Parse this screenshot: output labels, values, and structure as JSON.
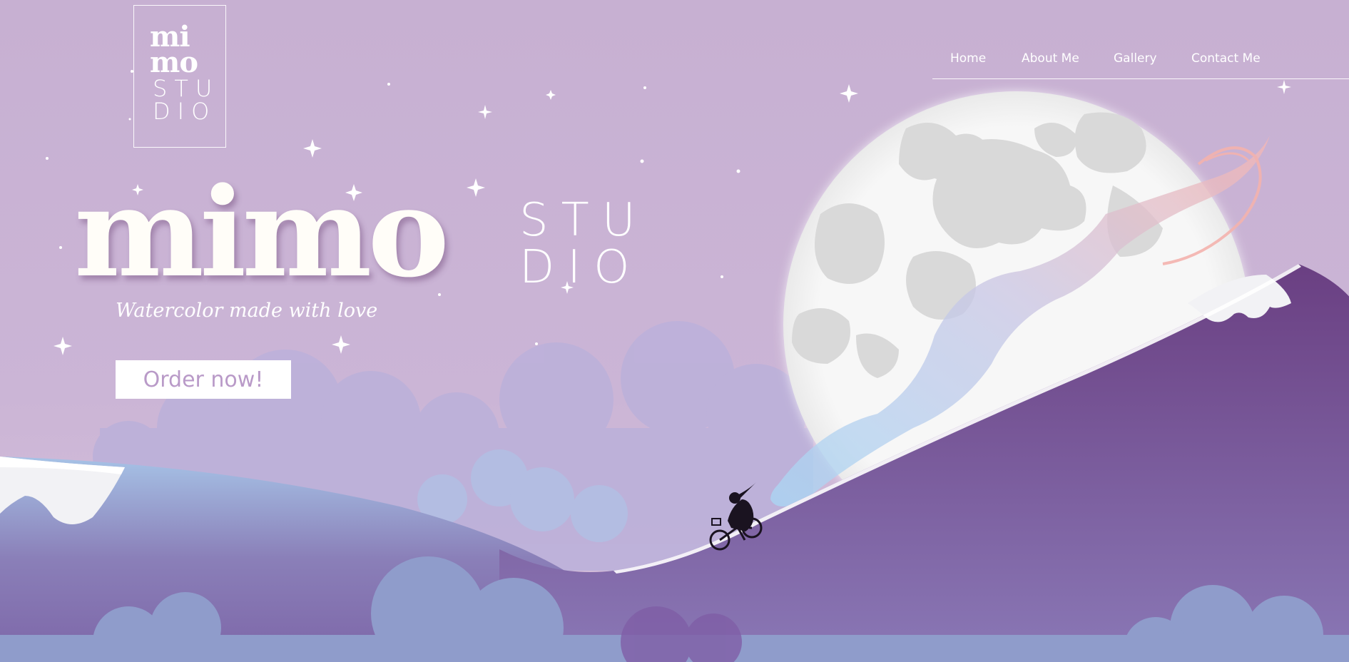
{
  "logo": {
    "line1": "mi mo",
    "line2": "STU DIO"
  },
  "nav": {
    "items": [
      {
        "label": "Home"
      },
      {
        "label": "About Me"
      },
      {
        "label": "Gallery"
      },
      {
        "label": "Contact Me"
      }
    ]
  },
  "hero": {
    "title": "mimo",
    "studio": "STU DIO",
    "tagline": "Watercolor made with love",
    "order_label": "Order now!"
  },
  "colors": {
    "sky": "#c9b2d3",
    "hill_dark": "#6e4385",
    "hill_mid": "#8a73b0",
    "cloud": "#b9b2da",
    "moon": "#f3f3f3",
    "button_text": "#b99ac8"
  }
}
